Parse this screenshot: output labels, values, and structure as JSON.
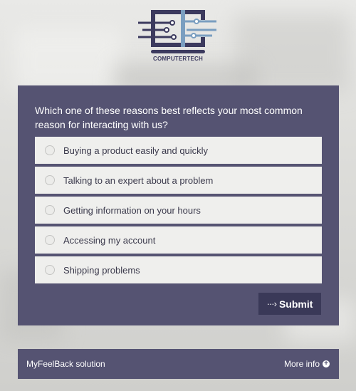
{
  "logo": {
    "text": "COMPUTERTECH",
    "colors": {
      "dark": "#3c3a5e",
      "accent": "#7a9ec0"
    }
  },
  "survey": {
    "question": "Which one of these reasons best reflects your most common reason for interacting with us?",
    "options": [
      {
        "label": "Buying a product easily and quickly"
      },
      {
        "label": "Talking to an expert about a problem"
      },
      {
        "label": "Getting information on your hours"
      },
      {
        "label": "Accessing my account"
      },
      {
        "label": "Shipping problems"
      }
    ],
    "submit_label": "Submit"
  },
  "footer": {
    "brand": "MyFeelBack solution",
    "more_info_label": "More info"
  },
  "colors": {
    "panel": "#555372",
    "button": "#3a3958",
    "option_bg": "#efefed"
  }
}
